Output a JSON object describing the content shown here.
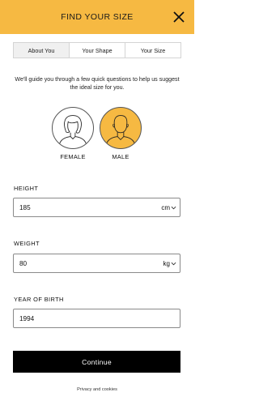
{
  "header": {
    "title": "FIND YOUR SIZE",
    "close_icon": "close-icon"
  },
  "tabs": [
    {
      "label": "About You",
      "active": true
    },
    {
      "label": "Your Shape",
      "active": false
    },
    {
      "label": "Your Size",
      "active": false
    }
  ],
  "intro": "We'll guide you through a few quick questions to help us suggest the ideal size for you.",
  "gender": {
    "female": {
      "label": "FEMALE",
      "icon": "female-avatar-icon",
      "selected": false
    },
    "male": {
      "label": "MALE",
      "icon": "male-avatar-icon",
      "selected": true
    }
  },
  "height": {
    "label": "HEIGHT",
    "value": "185",
    "unit": "cm"
  },
  "weight": {
    "label": "WEIGHT",
    "value": "80",
    "unit": "kg"
  },
  "birth_year": {
    "label": "YEAR OF BIRTH",
    "value": "1994"
  },
  "continue_label": "Continue",
  "privacy_label": "Privacy and cookies",
  "colors": {
    "accent": "#f6b942",
    "button": "#000000",
    "tab_active": "#f0f0f0"
  }
}
